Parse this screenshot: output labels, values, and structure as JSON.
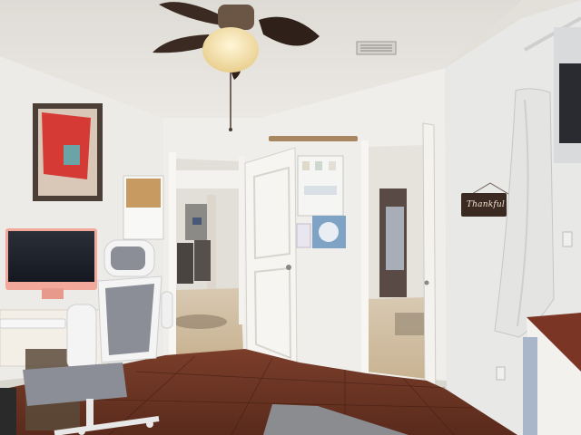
{
  "scene": {
    "sign_text": "Thankful",
    "colors": {
      "ceiling": "#e6e3de",
      "wall_left": "#ecebe8",
      "wall_right": "#e9e9e7",
      "floor_tile": "#6a3424",
      "door": "#f6f5f2",
      "monitor_frame": "#f2a99c",
      "desk_top": "#f3eee6",
      "chair_mesh": "#8b8e96",
      "fan_blade": "#3a2a22",
      "sign_board": "#3b2a22"
    },
    "icons": [
      "ceiling-fan-icon",
      "air-vent-icon",
      "light-switch-icon",
      "power-outlet-icon"
    ]
  }
}
